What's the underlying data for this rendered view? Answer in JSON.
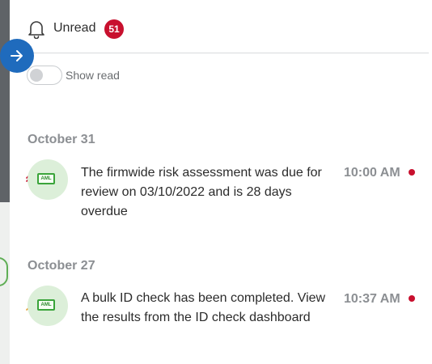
{
  "header": {
    "title": "Unread",
    "unread_count": "51"
  },
  "filter": {
    "show_read_label": "Show read",
    "show_read_enabled": false
  },
  "groups": [
    {
      "date": "October 31",
      "items": [
        {
          "tag": "AML",
          "priority": "high",
          "message": "The firmwide risk assessment was due for review on 03/10/2022 and is 28 days overdue",
          "time": "10:00 AM",
          "unread": true
        }
      ]
    },
    {
      "date": "October 27",
      "items": [
        {
          "tag": "AML",
          "priority": "medium",
          "message": "A bulk ID check has been completed. View the results from the ID check dashboard",
          "time": "10:37 AM",
          "unread": true
        }
      ]
    }
  ],
  "colors": {
    "accent": "#1f6bbd",
    "badge": "#c8102e",
    "high_priority": "#c8102e",
    "medium_priority": "#e39b2d",
    "tag_green": "#3aa43a",
    "avatar_bg": "#dcefd9"
  },
  "icons": {
    "collapse": "arrow-right-icon",
    "notifications": "bell-icon",
    "high_priority": "double-chevron-up-icon",
    "medium_priority": "chevron-up-icon"
  }
}
